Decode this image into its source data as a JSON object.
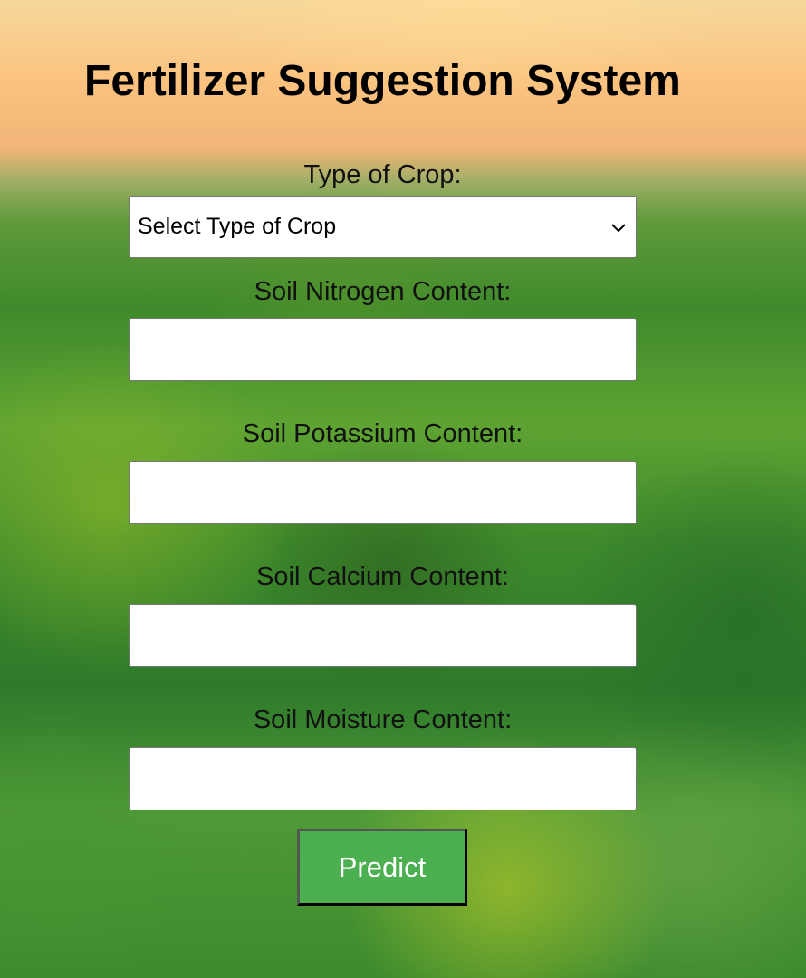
{
  "page": {
    "title": "Fertilizer Suggestion System"
  },
  "form": {
    "crop_type": {
      "label": "Type of Crop:",
      "selected": "Select Type of Crop",
      "icon": "chevron-down-icon"
    },
    "nitrogen": {
      "label": "Soil Nitrogen Content:",
      "value": ""
    },
    "potassium": {
      "label": "Soil Potassium Content:",
      "value": ""
    },
    "calcium": {
      "label": "Soil Calcium Content:",
      "value": ""
    },
    "moisture": {
      "label": "Soil Moisture Content:",
      "value": ""
    },
    "submit_label": "Predict"
  },
  "colors": {
    "button_bg": "#4caf50",
    "button_text": "#ffffff"
  }
}
